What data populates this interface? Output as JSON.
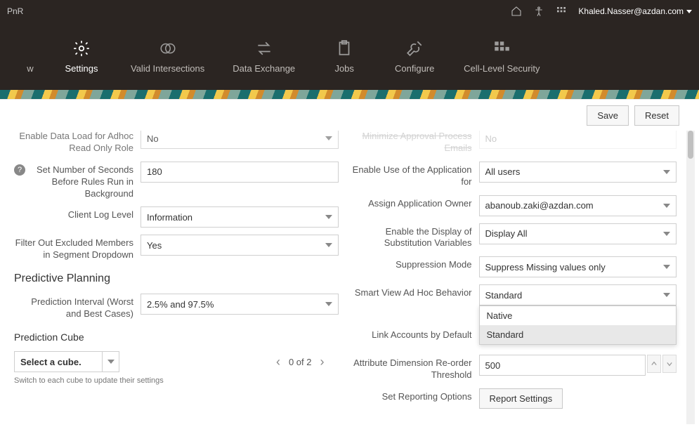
{
  "topbar": {
    "left_fragment": "PnR",
    "user_email": "Khaled.Nasser@azdan.com"
  },
  "nav": {
    "items": [
      {
        "label": "w",
        "icon": "blank"
      },
      {
        "label": "Settings",
        "icon": "gear"
      },
      {
        "label": "Valid Intersections",
        "icon": "venn"
      },
      {
        "label": "Data Exchange",
        "icon": "arrows"
      },
      {
        "label": "Jobs",
        "icon": "clipboard"
      },
      {
        "label": "Configure",
        "icon": "wrench"
      },
      {
        "label": "Cell-Level Security",
        "icon": "grid"
      }
    ]
  },
  "actions": {
    "save": "Save",
    "reset": "Reset"
  },
  "left_col": {
    "truncated_row_label": "Enable Data Load for Adhoc Read Only Role",
    "truncated_row_value": "No",
    "seconds_label": "Set Number of Seconds Before Rules Run in Background",
    "seconds_value": "180",
    "log_level_label": "Client Log Level",
    "log_level_value": "Information",
    "filter_label": "Filter Out Excluded Members in Segment Dropdown",
    "filter_value": "Yes",
    "section_predictive": "Predictive Planning",
    "pred_interval_label": "Prediction Interval (Worst and Best Cases)",
    "pred_interval_value": "2.5% and 97.5%",
    "pred_cube_title": "Prediction Cube",
    "cube_placeholder": "Select a cube.",
    "pager_text": "0 of 2",
    "switch_hint": "Switch to each cube to update their settings"
  },
  "right_col": {
    "truncated_row_label": "Minimize Approval Process Emails",
    "truncated_row_value": "No",
    "enable_use_label": "Enable Use of the Application for",
    "enable_use_value": "All users",
    "owner_label": "Assign Application Owner",
    "owner_value": "abanoub.zaki@azdan.com",
    "subst_label": "Enable the Display of Substitution Variables",
    "subst_value": "Display All",
    "supp_label": "Suppression Mode",
    "supp_value": "Suppress Missing values only",
    "smartview_label": "Smart View Ad Hoc Behavior",
    "smartview_value": "Standard",
    "smartview_options": [
      "Native",
      "Standard"
    ],
    "link_acc_label": "Link Accounts by Default",
    "attr_label": "Attribute Dimension Re-order Threshold",
    "attr_value": "500",
    "reporting_label": "Set Reporting Options",
    "reporting_btn": "Report Settings"
  }
}
